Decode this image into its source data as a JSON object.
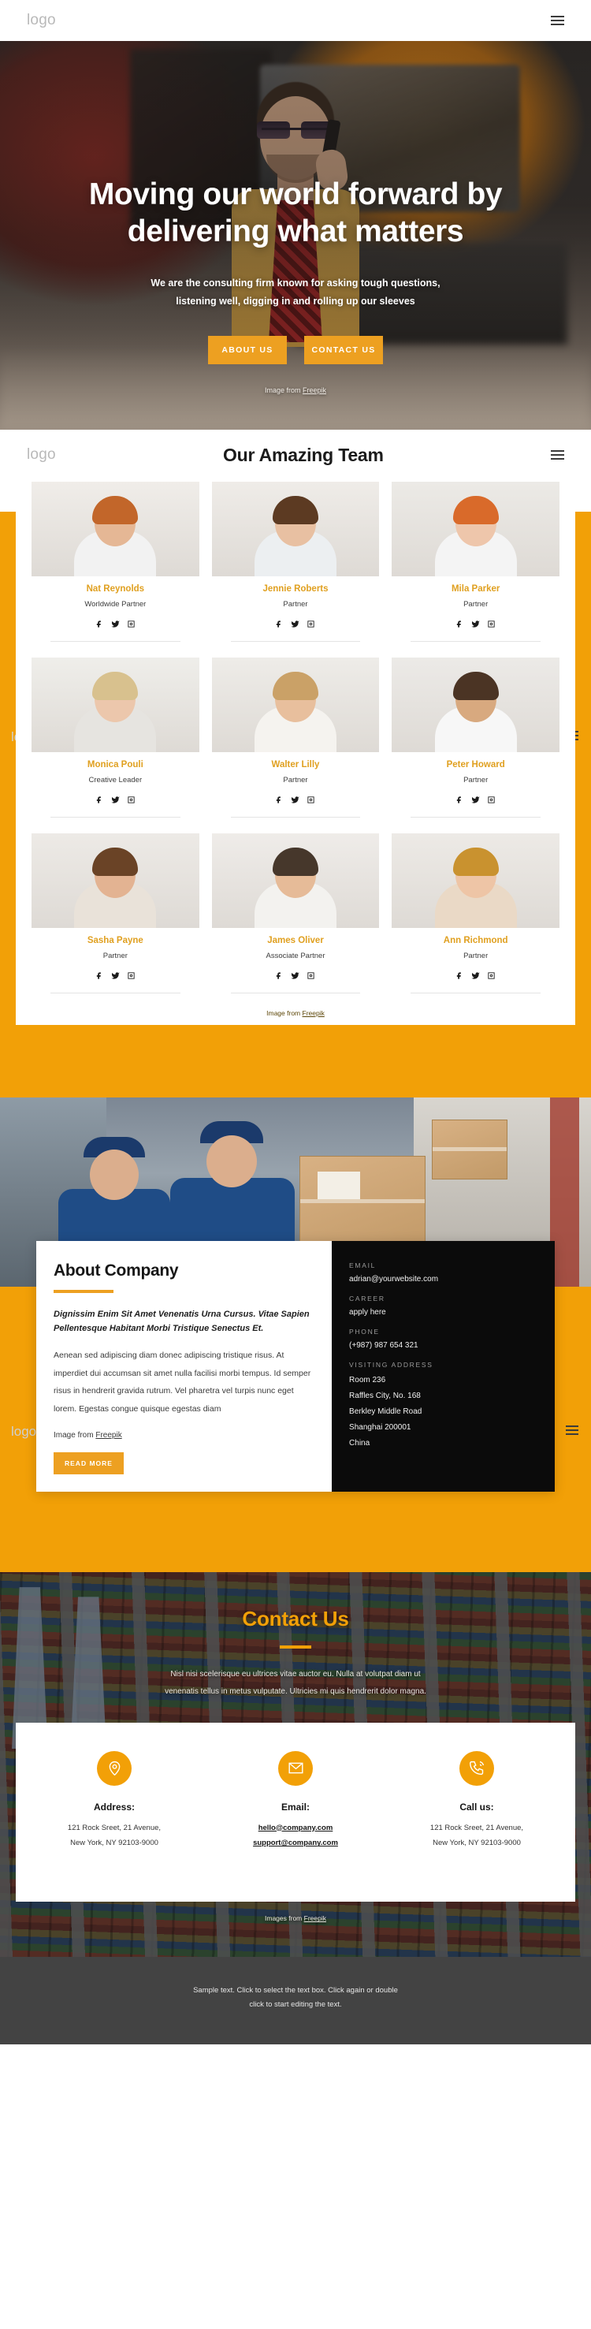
{
  "colors": {
    "accent": "#f2a007",
    "button": "#eda021",
    "dark_panel": "#0b0b0b",
    "footer": "#434343"
  },
  "topbar": {
    "logo": "logo",
    "menu_icon": "hamburger-icon"
  },
  "hero": {
    "title_line1": "Moving our world forward by",
    "title_line2": "delivering what matters",
    "subtitle_line1": "We are the consulting firm known for asking tough questions,",
    "subtitle_line2": "listening well, digging in and rolling up our sleeves",
    "button_about": "ABOUT US",
    "button_contact": "CONTACT US",
    "credit_prefix": "Image from ",
    "credit_link": "Freepik"
  },
  "team": {
    "logo": "logo",
    "title": "Our Amazing Team",
    "credit_prefix": "Image from ",
    "credit_link": "Freepik",
    "members": [
      {
        "name": "Nat Reynolds",
        "role": "Worldwide Partner"
      },
      {
        "name": "Jennie Roberts",
        "role": "Partner"
      },
      {
        "name": "Mila Parker",
        "role": "Partner"
      },
      {
        "name": "Monica Pouli",
        "role": "Creative Leader"
      },
      {
        "name": "Walter Lilly",
        "role": "Partner"
      },
      {
        "name": "Peter Howard",
        "role": "Partner"
      },
      {
        "name": "Sasha Payne",
        "role": "Partner"
      },
      {
        "name": "James Oliver",
        "role": "Associate Partner"
      },
      {
        "name": "Ann Richmond",
        "role": "Partner"
      }
    ]
  },
  "about": {
    "logo": "logo",
    "heading": "About Company",
    "lead": "Dignissim Enim Sit Amet Venenatis Urna Cursus. Vitae Sapien Pellentesque Habitant Morbi Tristique Senectus Et.",
    "body": "Aenean sed adipiscing diam donec adipiscing tristique risus. At imperdiet dui accumsan sit amet nulla facilisi morbi tempus. Id semper risus in hendrerit gravida rutrum. Vel pharetra vel turpis nunc eget lorem. Egestas congue quisque egestas diam",
    "credit_prefix": "Image from ",
    "credit_link": "Freepik",
    "read_more": "READ MORE",
    "contact_panel": {
      "email_label": "EMAIL",
      "email_value": "adrian@yourwebsite.com",
      "career_label": "CAREER",
      "career_value": "apply here",
      "phone_label": "PHONE",
      "phone_value": "(+987) 987 654 321",
      "address_label": "VISITING ADDRESS",
      "address_lines": [
        "Room 236",
        "Raffles City, No. 168",
        "Berkley Middle Road",
        "Shanghai 200001",
        "China"
      ]
    }
  },
  "contact": {
    "heading": "Contact Us",
    "sub_line1": "Nisl nisi scelerisque eu ultrices vitae auctor eu. Nulla at volutpat diam ut",
    "sub_line2": "venenatis tellus in metus vulputate. Ultricies mi quis hendrerit dolor magna.",
    "credit_prefix": "Images from ",
    "credit_link": "Freepik",
    "cards": [
      {
        "icon": "location-pin-icon",
        "title": "Address:",
        "line1": "121 Rock Sreet, 21 Avenue,",
        "line2": "New York, NY 92103-9000"
      },
      {
        "icon": "envelope-icon",
        "title": "Email:",
        "line1": "hello@company.com",
        "line2": "support@company.com"
      },
      {
        "icon": "phone-icon",
        "title": "Call us:",
        "line1": "121 Rock Sreet, 21 Avenue,",
        "line2": "New York, NY 92103-9000"
      }
    ]
  },
  "footer": {
    "line1": "Sample text. Click to select the text box. Click again or double",
    "line2": "click to start editing the text."
  }
}
